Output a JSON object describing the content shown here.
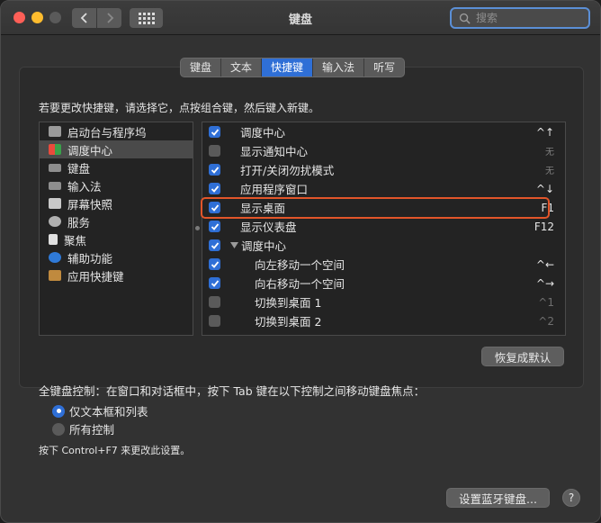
{
  "window": {
    "title": "键盘"
  },
  "search": {
    "placeholder": "搜索"
  },
  "tabs": [
    {
      "label": "键盘",
      "active": false
    },
    {
      "label": "文本",
      "active": false
    },
    {
      "label": "快捷键",
      "active": true
    },
    {
      "label": "输入法",
      "active": false
    },
    {
      "label": "听写",
      "active": false
    }
  ],
  "instruction": "若要更改快捷键，请选择它，点按组合键，然后键入新键。",
  "categories": [
    {
      "label": "启动台与程序坞",
      "icon": "launchpad-icon",
      "selected": false
    },
    {
      "label": "调度中心",
      "icon": "mission-control-icon",
      "selected": true
    },
    {
      "label": "键盘",
      "icon": "keyboard-icon",
      "selected": false
    },
    {
      "label": "输入法",
      "icon": "input-method-icon",
      "selected": false
    },
    {
      "label": "屏幕快照",
      "icon": "screenshot-icon",
      "selected": false
    },
    {
      "label": "服务",
      "icon": "services-gear-icon",
      "selected": false
    },
    {
      "label": "聚焦",
      "icon": "spotlight-icon",
      "selected": false
    },
    {
      "label": "辅助功能",
      "icon": "accessibility-icon",
      "selected": false
    },
    {
      "label": "应用快捷键",
      "icon": "app-shortcuts-icon",
      "selected": false
    }
  ],
  "shortcuts": [
    {
      "label": "调度中心",
      "checked": true,
      "key": "^↑",
      "style": "normal",
      "level": "top"
    },
    {
      "label": "显示通知中心",
      "checked": false,
      "key": "无",
      "style": "dim",
      "level": "top"
    },
    {
      "label": "打开/关闭勿扰模式",
      "checked": true,
      "key": "无",
      "style": "dim",
      "level": "top"
    },
    {
      "label": "应用程序窗口",
      "checked": true,
      "key": "^↓",
      "style": "normal",
      "level": "top"
    },
    {
      "label": "显示桌面",
      "checked": true,
      "key": "F1",
      "style": "normal",
      "level": "top"
    },
    {
      "label": "显示仪表盘",
      "checked": true,
      "key": "F12",
      "style": "normal",
      "level": "top"
    },
    {
      "label": "调度中心",
      "checked": true,
      "key": "",
      "style": "normal",
      "level": "group"
    },
    {
      "label": "向左移动一个空间",
      "checked": true,
      "key": "^←",
      "style": "normal",
      "level": "sub"
    },
    {
      "label": "向右移动一个空间",
      "checked": true,
      "key": "^→",
      "style": "normal",
      "level": "sub"
    },
    {
      "label": "切换到桌面 1",
      "checked": false,
      "key": "^1",
      "style": "grey",
      "level": "sub"
    },
    {
      "label": "切换到桌面 2",
      "checked": false,
      "key": "^2",
      "style": "grey",
      "level": "sub"
    }
  ],
  "restore_button": "恢复成默认",
  "full_keyboard": {
    "label": "全键盘控制：在窗口和对话框中，按下 Tab 键在以下控制之间移动键盘焦点：",
    "options": [
      {
        "label": "仅文本框和列表",
        "selected": true
      },
      {
        "label": "所有控制",
        "selected": false
      }
    ],
    "hint": "按下 Control+F7 来更改此设置。"
  },
  "bluetooth_button": "设置蓝牙键盘...",
  "help_button": "?",
  "colors": {
    "accent": "#2f6fd6",
    "highlight": "#e2552a"
  }
}
